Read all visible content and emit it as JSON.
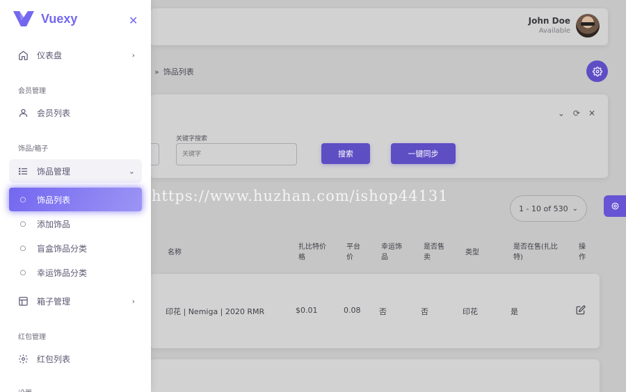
{
  "brand": {
    "name": "Vuexy"
  },
  "header": {
    "user_name": "John Doe",
    "user_status": "Available"
  },
  "breadcrumb": {
    "separator": "»",
    "current": "饰品列表"
  },
  "filter": {
    "keyword_label": "关键字搜索",
    "keyword_placeholder": "关键字",
    "search_button": "搜索",
    "sync_button": "一键同步"
  },
  "watermark": "https://www.huzhan.com/ishop44131",
  "pagination": {
    "range": "1 - 10 of 530"
  },
  "table": {
    "headers": [
      "名称",
      "扎比特价格",
      "平台价",
      "幸运饰品",
      "是否售卖",
      "类型",
      "是否在售(扎比特)",
      "操作"
    ],
    "header_lines": [
      [
        "名称"
      ],
      [
        "扎比特价",
        "格"
      ],
      [
        "平台",
        "价"
      ],
      [
        "幸运饰",
        "品"
      ],
      [
        "是否售",
        "卖"
      ],
      [
        "类型"
      ],
      [
        "是否在售(扎比",
        "特)"
      ],
      [
        "操",
        "作"
      ]
    ],
    "rows": [
      {
        "name": "印花 | Nemiga | 2020 RMR",
        "zbt_price": "$0.01",
        "platform_price": "0.08",
        "lucky": "否",
        "on_sale": "否",
        "type": "印花",
        "zbt_on_sale": "是"
      }
    ]
  },
  "sidebar": {
    "dashboard": "仪表盘",
    "section_members": "会员管理",
    "member_list": "会员列表",
    "section_items": "饰品/箱子",
    "item_manage": "饰品管理",
    "item_list": "饰品列表",
    "add_item": "添加饰品",
    "blindbox_category": "盲盒饰品分类",
    "lucky_category": "幸运饰品分类",
    "box_manage": "箱子管理",
    "section_redpacket": "红包管理",
    "redpacket_list": "红包列表",
    "section_settings": "设置"
  },
  "colors": {
    "primary": "#7367f0",
    "overlay_primary": "#5d4ec4",
    "text": "#5e5873"
  }
}
